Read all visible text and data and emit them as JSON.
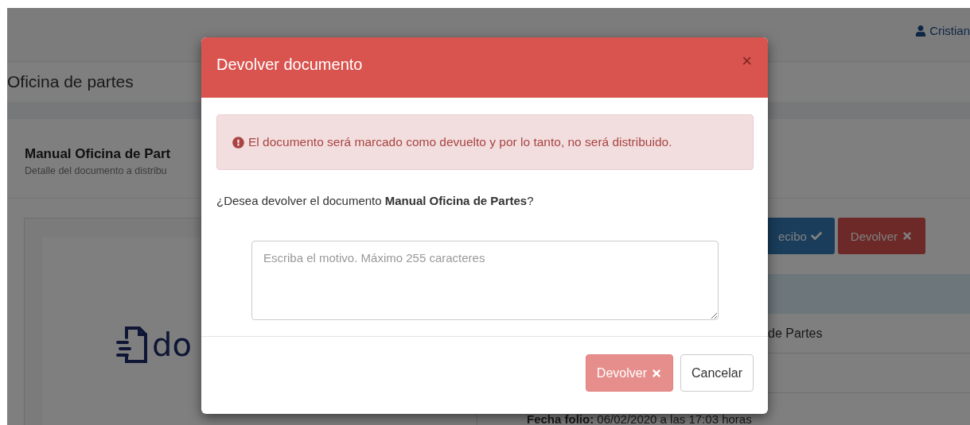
{
  "navbar": {
    "user": "Cristian"
  },
  "page_header": {
    "title": "Oficina de partes"
  },
  "card": {
    "title": "Manual Oficina de Part",
    "subtitle": "Detalle del documento a distribu",
    "logo_text": "do",
    "actions": [
      {
        "label": "ecibo",
        "kind": "primary"
      },
      {
        "label": "Devolver",
        "kind": "danger"
      }
    ],
    "rows": [
      {
        "kind": "text",
        "text": "de Partes"
      },
      {
        "kind": "blank"
      },
      {
        "kind": "field",
        "label": "Fecha folio:",
        "text": "06/02/2020 a las 17:03 horas"
      }
    ]
  },
  "modal": {
    "title": "Devolver documento",
    "close": "×",
    "alert": "El documento será marcado como devuelto y por lo tanto, no será distribuido.",
    "question": "¿Desea devolver el documento **Manual Oficina de Partes**?",
    "reason_field": {
      "placeholder": "Escriba el motivo. Máximo 255 caracteres"
    },
    "buttons": [
      {
        "label": "Devolver",
        "kind": "danger",
        "disabled": true
      },
      {
        "label": "Cancelar",
        "kind": "default",
        "disabled": false
      }
    ]
  }
}
